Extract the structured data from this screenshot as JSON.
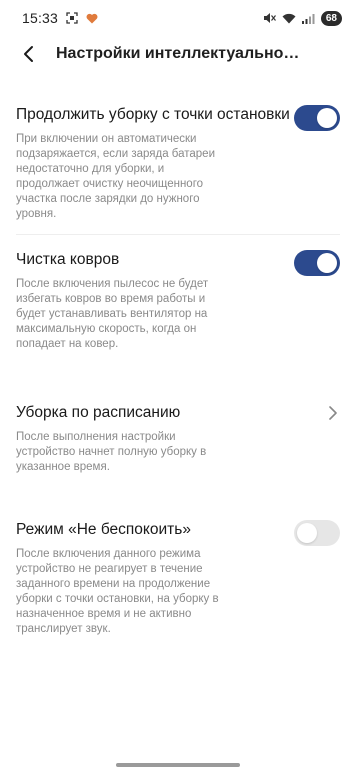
{
  "status_bar": {
    "time": "15:33",
    "battery": "68",
    "icons": [
      "screenshot-icon",
      "heart-icon",
      "mute-icon",
      "wifi-icon",
      "signal-icon"
    ]
  },
  "header": {
    "title": "Настройки интеллектуальной о..."
  },
  "settings": [
    {
      "title": "Продолжить уборку с точки остановки",
      "desc": "При включении он автоматически подзаряжается, если заряда батареи недостаточно для уборки, и продолжает очистку неочищенного участка после зарядки до нужного уровня.",
      "control": "toggle",
      "on": true
    },
    {
      "title": "Чистка ковров",
      "desc": "После включения пылесос не будет избегать ковров во время работы и будет устанавливать вентилятор на максимальную скорость, когда он попадает на ковер.",
      "control": "toggle",
      "on": true
    },
    {
      "title": "Уборка по расписанию",
      "desc": "После выполнения настройки устройство начнет полную уборку в указанное время.",
      "control": "chevron"
    },
    {
      "title": "Режим «Не беспокоить»",
      "desc": "После включения данного режима устройство не реагирует в течение заданного времени на продолжение уборки с точки остановки, на уборку в назначенное время и не активно транслирует звук.",
      "control": "toggle",
      "on": false
    }
  ],
  "colors": {
    "toggle_on": "#2c4a8e",
    "toggle_off": "#e6e6e6",
    "desc_text": "#8a8a8a"
  }
}
